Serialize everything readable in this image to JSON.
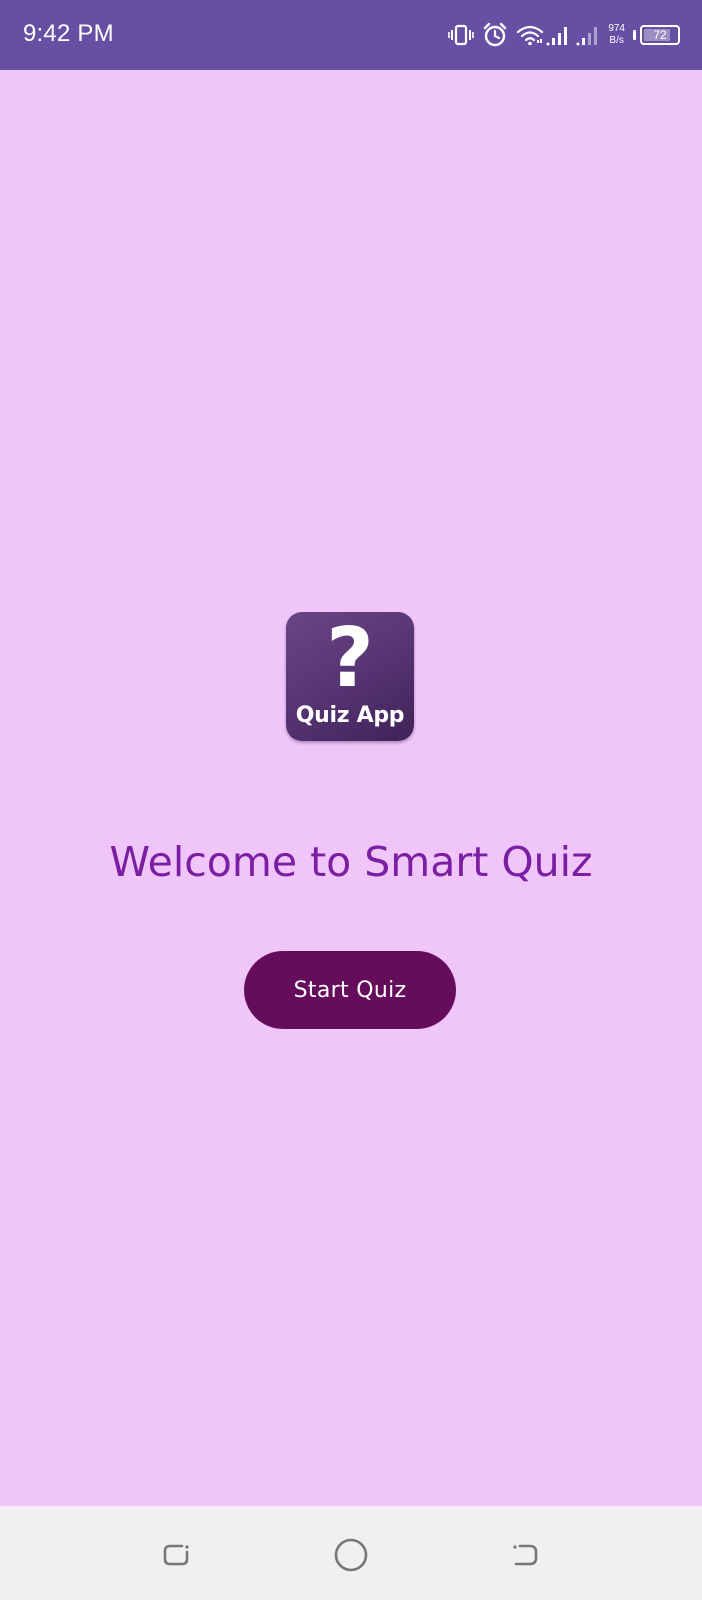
{
  "status_bar": {
    "time": "9:42 PM",
    "net_speed_value": "974",
    "net_speed_unit": "B/s",
    "battery_level": "72",
    "icons": [
      "vibrate-icon",
      "alarm-icon",
      "wifi-icon",
      "signal-1-icon",
      "signal-2-icon"
    ]
  },
  "logo": {
    "symbol": "?",
    "text": "Quiz App"
  },
  "main": {
    "title": "Welcome to Smart Quiz",
    "start_button_label": "Start Quiz"
  },
  "nav_bar": {
    "buttons": [
      "recents-button",
      "home-button",
      "back-button"
    ]
  },
  "colors": {
    "status_bar": "#6750a4",
    "background": "#f0c6fa",
    "title": "#7b1fa2",
    "button": "#650d5b",
    "nav_bar": "#f0f0f0"
  }
}
